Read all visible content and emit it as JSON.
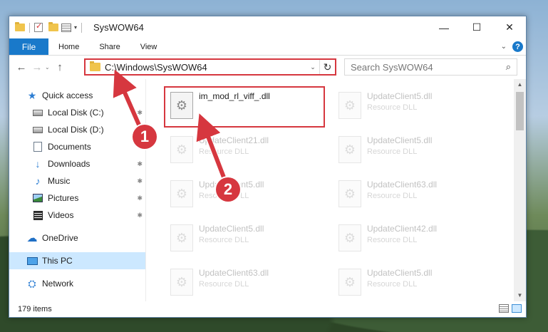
{
  "titlebar": {
    "title": "SysWOW64",
    "minimize_icon": "—",
    "maximize_icon": "☐",
    "close_icon": "✕"
  },
  "ribbon": {
    "tabs": [
      "File",
      "Home",
      "Share",
      "View"
    ],
    "expand_icon": "⌄",
    "help_label": "?"
  },
  "navigation": {
    "back_icon": "←",
    "forward_icon": "→",
    "recent_icon": "⌄",
    "up_icon": "↑",
    "address": "C:\\Windows\\SysWOW64",
    "address_dropdown_icon": "⌄",
    "refresh_icon": "↻",
    "search_placeholder": "Search SysWOW64",
    "search_icon": "⌕"
  },
  "sidebar": {
    "items": [
      {
        "label": "Quick access",
        "icon": "star-icon",
        "pinned": false
      },
      {
        "label": "Local Disk (C:)",
        "icon": "disk-icon",
        "pinned": true
      },
      {
        "label": "Local Disk (D:)",
        "icon": "disk-icon",
        "pinned": true
      },
      {
        "label": "Documents",
        "icon": "documents-icon",
        "pinned": true
      },
      {
        "label": "Downloads",
        "icon": "download-icon",
        "pinned": true
      },
      {
        "label": "Music",
        "icon": "music-icon",
        "pinned": true
      },
      {
        "label": "Pictures",
        "icon": "pictures-icon",
        "pinned": true
      },
      {
        "label": "Videos",
        "icon": "videos-icon",
        "pinned": true
      },
      {
        "label": "OneDrive",
        "icon": "cloud-icon",
        "pinned": false
      },
      {
        "label": "This PC",
        "icon": "pc-icon",
        "pinned": false,
        "selected": true
      },
      {
        "label": "Network",
        "icon": "network-icon",
        "pinned": false
      }
    ],
    "pin_glyph": "📌"
  },
  "files": [
    {
      "name": "im_mod_rl_viff_.dll",
      "type": "",
      "highlighted": true
    },
    {
      "name": "UpdateClient5.dll",
      "type": "Resource DLL"
    },
    {
      "name": "UpdateClient21.dll",
      "type": "Resource DLL"
    },
    {
      "name": "UpdateClient5.dll",
      "type": "Resource DLL"
    },
    {
      "name": "UpdateClient5.dll",
      "type": "Resource DLL"
    },
    {
      "name": "UpdateClient63.dll",
      "type": "Resource DLL"
    },
    {
      "name": "UpdateClient5.dll",
      "type": "Resource DLL"
    },
    {
      "name": "UpdateClient42.dll",
      "type": "Resource DLL"
    },
    {
      "name": "UpdateClient63.dll",
      "type": "Resource DLL"
    },
    {
      "name": "UpdateClient5.dll",
      "type": "Resource DLL"
    }
  ],
  "status": {
    "item_count": "179 items"
  },
  "annotations": {
    "callout_1": "1",
    "callout_2": "2",
    "color": "#d6373f"
  }
}
